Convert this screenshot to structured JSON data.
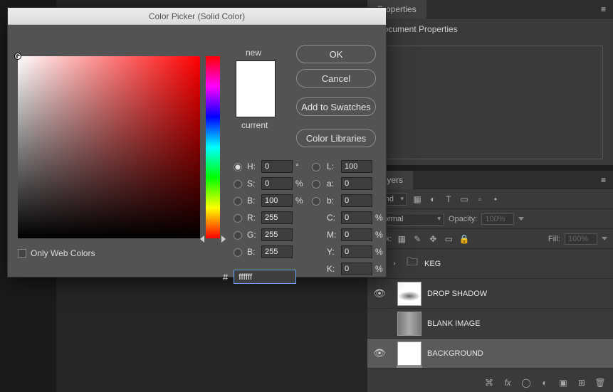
{
  "dialog": {
    "title": "Color Picker (Solid Color)",
    "new_label": "new",
    "current_label": "current",
    "ok": "OK",
    "cancel": "Cancel",
    "add_swatches": "Add to Swatches",
    "color_libraries": "Color Libraries",
    "only_web": "Only Web Colors",
    "fields": {
      "H": {
        "label": "H:",
        "value": "0",
        "unit": "°"
      },
      "S": {
        "label": "S:",
        "value": "0",
        "unit": "%"
      },
      "Bv": {
        "label": "B:",
        "value": "100",
        "unit": "%"
      },
      "R": {
        "label": "R:",
        "value": "255",
        "unit": ""
      },
      "G": {
        "label": "G:",
        "value": "255",
        "unit": ""
      },
      "Bb": {
        "label": "B:",
        "value": "255",
        "unit": ""
      },
      "L": {
        "label": "L:",
        "value": "100",
        "unit": ""
      },
      "a": {
        "label": "a:",
        "value": "0",
        "unit": ""
      },
      "b": {
        "label": "b:",
        "value": "0",
        "unit": ""
      },
      "C": {
        "label": "C:",
        "value": "0",
        "unit": "%"
      },
      "M": {
        "label": "M:",
        "value": "0",
        "unit": "%"
      },
      "Y": {
        "label": "Y:",
        "value": "0",
        "unit": "%"
      },
      "K": {
        "label": "K:",
        "value": "0",
        "unit": "%"
      }
    },
    "hex_label": "#",
    "hex_value": "ffffff"
  },
  "properties_panel": {
    "tab": "Properties",
    "heading": "Document Properties"
  },
  "layers_panel": {
    "tab": "Layers",
    "kind": "Kind",
    "blend_mode": "Normal",
    "opacity_label": "Opacity:",
    "opacity_value": "100%",
    "fill_label": "Fill:",
    "fill_value": "100%",
    "lock_label": "Lock:",
    "icons": {
      "filter_image": "▦",
      "filter_adjust": "◐",
      "filter_type": "T",
      "filter_shape": "▭",
      "filter_smart": "▫",
      "filter_dot": "•",
      "lock_transparent": "▦",
      "lock_paint": "✎",
      "lock_move": "✥",
      "lock_artboard": "▭",
      "lock_all": "🔒"
    },
    "layers": [
      {
        "name": "KEG",
        "visible": true,
        "type": "group"
      },
      {
        "name": "DROP SHADOW",
        "visible": true,
        "type": "shadow"
      },
      {
        "name": "BLANK IMAGE",
        "visible": false,
        "type": "blank"
      },
      {
        "name": "BACKGROUND",
        "visible": true,
        "type": "white",
        "selected": true
      }
    ],
    "footer_icons": {
      "link": "⌘",
      "fx": "fx",
      "mask": "◯",
      "adjust": "◐",
      "group": "▣",
      "new": "⊞",
      "trash": "🗑"
    }
  }
}
